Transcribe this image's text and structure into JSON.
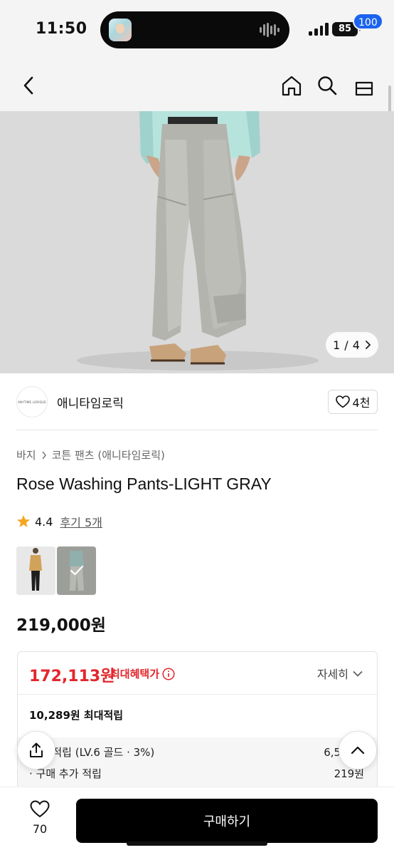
{
  "status_bar": {
    "time": "11:50",
    "battery": "85"
  },
  "nav": {
    "cart_count": "100"
  },
  "gallery": {
    "current": "1",
    "total": "4",
    "separator": "/"
  },
  "brand": {
    "logo_text": "ANYTIME LORIQUE",
    "name": "애니타임로릭",
    "likes": "4천"
  },
  "breadcrumb": {
    "category": "바지",
    "subcategory": "코튼 팬츠 (애니타임로릭)"
  },
  "product": {
    "title": "Rose Washing Pants-LIGHT GRAY",
    "rating": "4.4",
    "reviews": "후기 5개",
    "price": "219,000원"
  },
  "benefit": {
    "max_price": "172,113원",
    "max_label": "최대혜택가",
    "detail": "자세히",
    "points_total": "10,289원 최대적립",
    "rows": [
      {
        "label": "등급 적립 (LV.6 골드 · 3%)",
        "value": "6,570원"
      },
      {
        "label": "· 구매 추가 적립",
        "value": "219원"
      }
    ]
  },
  "bottom": {
    "wish_count": "70",
    "buy_label": "구매하기"
  },
  "colors": {
    "accent_red": "#e3262c",
    "badge_blue": "#1c63f0",
    "star": "#f5a623",
    "buy_bg": "#000000"
  }
}
